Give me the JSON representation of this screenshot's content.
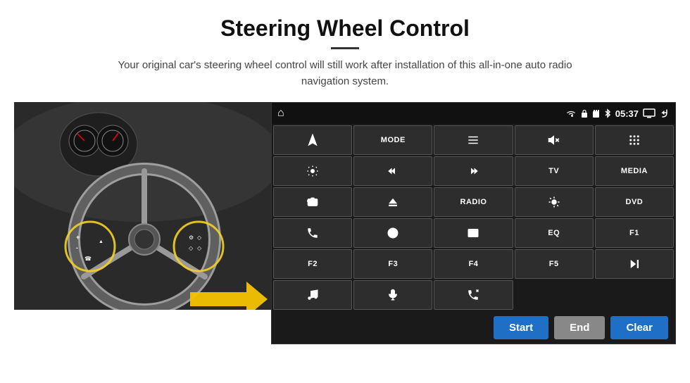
{
  "header": {
    "title": "Steering Wheel Control",
    "divider": true,
    "subtitle": "Your original car's steering wheel control will still work after installation of this all-in-one auto radio navigation system."
  },
  "statusBar": {
    "homeIcon": "⌂",
    "wifiIcon": "wifi",
    "lockIcon": "lock",
    "sdIcon": "sd",
    "bluetoothIcon": "bluetooth",
    "time": "05:37",
    "screenIcon": "screen",
    "backIcon": "back"
  },
  "buttons": [
    [
      {
        "id": "navigate",
        "type": "icon",
        "icon": "navigate",
        "label": ""
      },
      {
        "id": "mode",
        "type": "text",
        "label": "MODE"
      },
      {
        "id": "list",
        "type": "icon",
        "icon": "list",
        "label": ""
      },
      {
        "id": "mute",
        "type": "icon",
        "icon": "mute",
        "label": ""
      },
      {
        "id": "apps",
        "type": "icon",
        "icon": "apps",
        "label": ""
      }
    ],
    [
      {
        "id": "settings",
        "type": "icon",
        "icon": "settings",
        "label": ""
      },
      {
        "id": "prev",
        "type": "icon",
        "icon": "prev",
        "label": ""
      },
      {
        "id": "next",
        "type": "icon",
        "icon": "next",
        "label": ""
      },
      {
        "id": "tv",
        "type": "text",
        "label": "TV"
      },
      {
        "id": "media",
        "type": "text",
        "label": "MEDIA"
      }
    ],
    [
      {
        "id": "cam360",
        "type": "icon",
        "icon": "360cam",
        "label": ""
      },
      {
        "id": "eject",
        "type": "icon",
        "icon": "eject",
        "label": ""
      },
      {
        "id": "radio",
        "type": "text",
        "label": "RADIO"
      },
      {
        "id": "brightness",
        "type": "icon",
        "icon": "brightness",
        "label": ""
      },
      {
        "id": "dvd",
        "type": "text",
        "label": "DVD"
      }
    ],
    [
      {
        "id": "phone",
        "type": "icon",
        "icon": "phone",
        "label": ""
      },
      {
        "id": "globe",
        "type": "icon",
        "icon": "globe",
        "label": ""
      },
      {
        "id": "window",
        "type": "icon",
        "icon": "window",
        "label": ""
      },
      {
        "id": "eq",
        "type": "text",
        "label": "EQ"
      },
      {
        "id": "f1",
        "type": "text",
        "label": "F1"
      }
    ],
    [
      {
        "id": "f2",
        "type": "text",
        "label": "F2"
      },
      {
        "id": "f3",
        "type": "text",
        "label": "F3"
      },
      {
        "id": "f4",
        "type": "text",
        "label": "F4"
      },
      {
        "id": "f5",
        "type": "text",
        "label": "F5"
      },
      {
        "id": "playpause",
        "type": "icon",
        "icon": "playpause",
        "label": ""
      }
    ],
    [
      {
        "id": "music",
        "type": "icon",
        "icon": "music",
        "label": ""
      },
      {
        "id": "mic",
        "type": "icon",
        "icon": "mic",
        "label": ""
      },
      {
        "id": "phonecall",
        "type": "icon",
        "icon": "phonecall",
        "label": ""
      },
      {
        "id": "empty1",
        "type": "empty",
        "label": ""
      },
      {
        "id": "empty2",
        "type": "empty",
        "label": ""
      }
    ]
  ],
  "bottomBar": {
    "startLabel": "Start",
    "endLabel": "End",
    "clearLabel": "Clear"
  }
}
